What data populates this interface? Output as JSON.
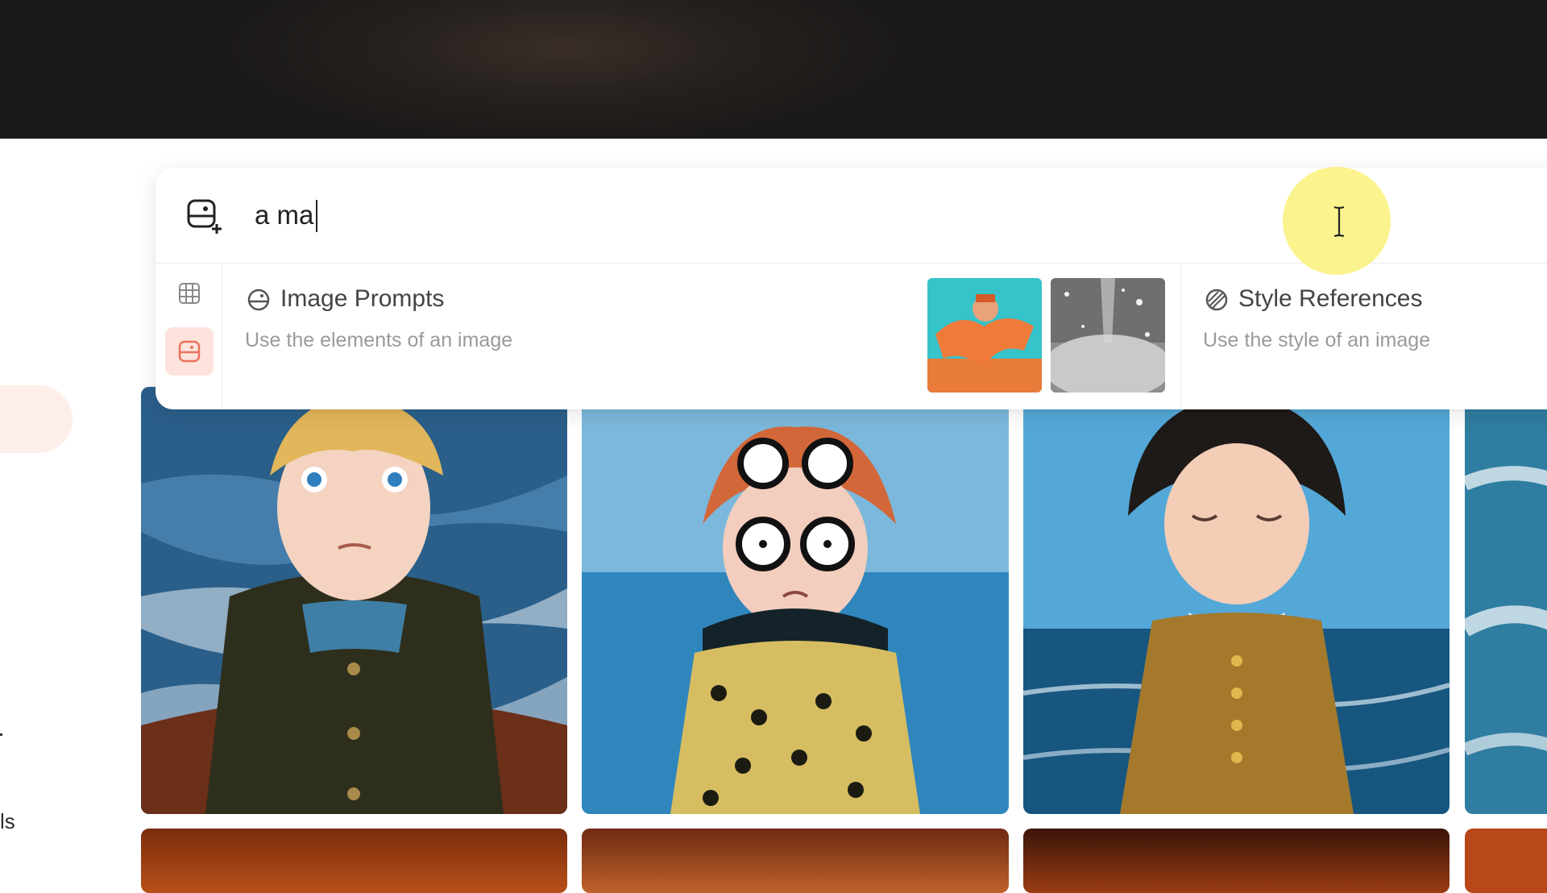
{
  "search": {
    "value": "a ma",
    "placeholder": ""
  },
  "image_prompts": {
    "title": "Image Prompts",
    "description": "Use the elements of an image"
  },
  "style_references": {
    "title": "Style References",
    "description": "Use the style of an image"
  },
  "sidebar": {
    "partial_label": "ls"
  },
  "icons": {
    "add_image": "image-add-icon",
    "grid": "grid-icon",
    "image_prompt_mode": "image-prompt-icon",
    "image_prompts": "image-prompt-icon",
    "style_references": "style-reference-icon",
    "cursor": "text-cursor-icon"
  },
  "colors": {
    "accent_bg": "#fde3dc",
    "accent": "#e8735a",
    "highlight": "#f8ec6a"
  }
}
